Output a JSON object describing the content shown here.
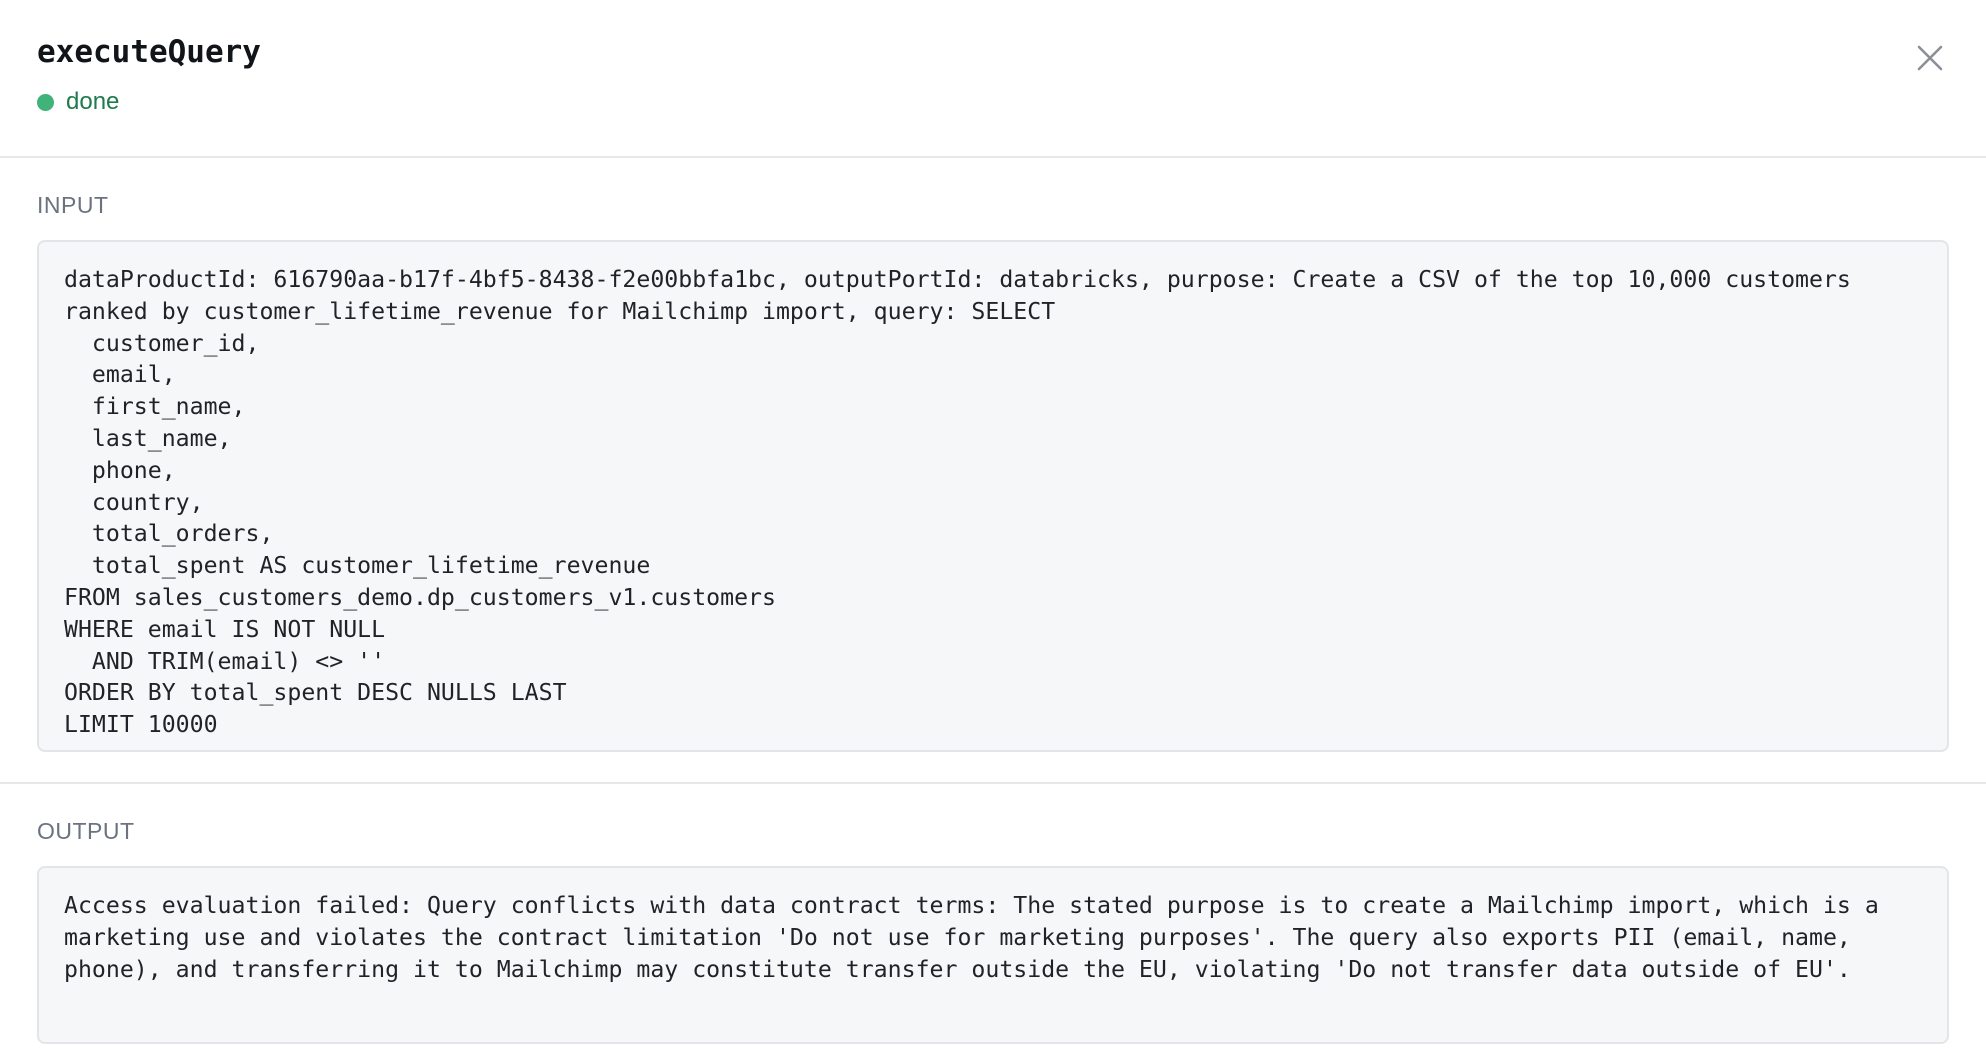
{
  "dialog": {
    "title": "executeQuery",
    "status": "done",
    "status_color": "#3fb37a",
    "close_icon": "close-icon"
  },
  "input": {
    "label": "INPUT",
    "text": "dataProductId: 616790aa-b17f-4bf5-8438-f2e00bbfa1bc, outputPortId: databricks, purpose: Create a CSV of the top 10,000 customers ranked by customer_lifetime_revenue for Mailchimp import, query: SELECT\n  customer_id,\n  email,\n  first_name,\n  last_name,\n  phone,\n  country,\n  total_orders,\n  total_spent AS customer_lifetime_revenue\nFROM sales_customers_demo.dp_customers_v1.customers\nWHERE email IS NOT NULL\n  AND TRIM(email) <> ''\nORDER BY total_spent DESC NULLS LAST\nLIMIT 10000"
  },
  "output": {
    "label": "OUTPUT",
    "text": "Access evaluation failed: Query conflicts with data contract terms: The stated purpose is to create a Mailchimp import, which is a marketing use and violates the contract limitation 'Do not use for marketing purposes'. The query also exports PII (email, name, phone), and transferring it to Mailchimp may constitute transfer outside the EU, violating 'Do not transfer data outside of EU'."
  }
}
